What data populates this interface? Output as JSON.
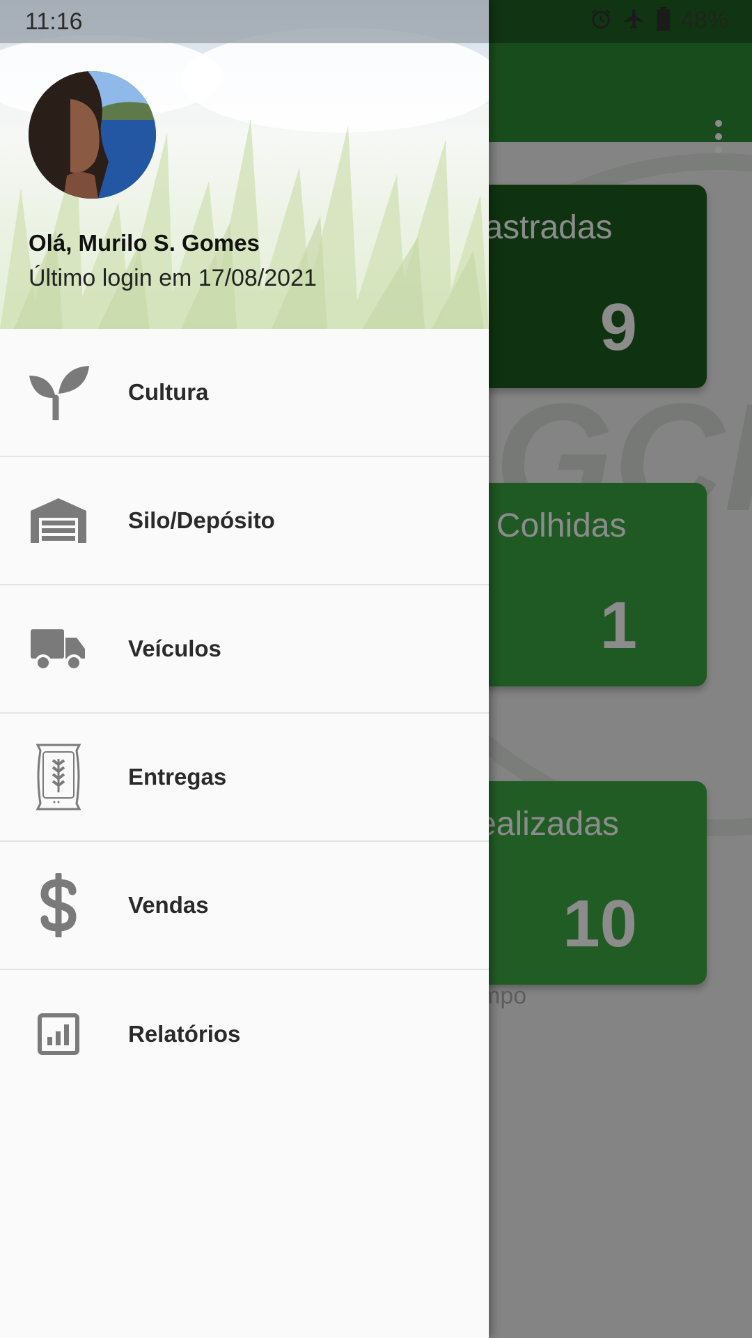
{
  "status_bar": {
    "time": "11:16",
    "battery": "48%"
  },
  "drawer": {
    "greeting": "Olá, Murilo S. Gomes",
    "last_login": "Último login em 17/08/2021",
    "items": [
      {
        "label": "Cultura",
        "icon": "sprout-icon"
      },
      {
        "label": "Silo/Depósito",
        "icon": "warehouse-icon"
      },
      {
        "label": "Veículos",
        "icon": "truck-icon"
      },
      {
        "label": "Entregas",
        "icon": "grain-sack-icon"
      },
      {
        "label": "Vendas",
        "icon": "dollar-icon"
      },
      {
        "label": "Relatórios",
        "icon": "report-icon"
      }
    ]
  },
  "background": {
    "cards": [
      {
        "label": "astradas",
        "value": "9"
      },
      {
        "label": "s Colhidas",
        "value": "1"
      },
      {
        "label": "ealizadas",
        "value": "10"
      }
    ],
    "footnote": "mpo",
    "watermark": "GCF"
  },
  "colors": {
    "primary": "#2f8a36",
    "primary_dark": "#1f5f23",
    "icon_gray": "#7a7a7a"
  }
}
